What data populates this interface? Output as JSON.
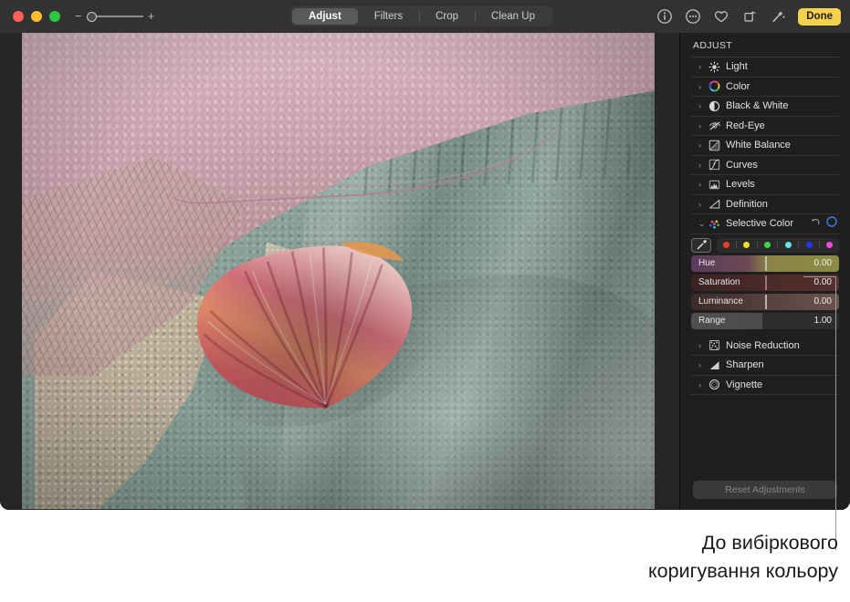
{
  "window": {
    "traffic_lights": [
      "close",
      "minimize",
      "zoom"
    ],
    "zoom_control": {
      "minus": "−",
      "plus": "+",
      "value_position_pct": 0
    }
  },
  "toolbar": {
    "tabs": [
      {
        "label": "Adjust",
        "active": true
      },
      {
        "label": "Filters",
        "active": false
      },
      {
        "label": "Crop",
        "active": false
      },
      {
        "label": "Clean Up",
        "active": false
      }
    ],
    "icons": [
      {
        "name": "info-icon"
      },
      {
        "name": "more-options-icon"
      },
      {
        "name": "favorite-heart-icon"
      },
      {
        "name": "rotate-icon"
      },
      {
        "name": "auto-enhance-wand-icon"
      }
    ],
    "done_label": "Done",
    "done_color": "#f5d24d"
  },
  "sidebar": {
    "title": "ADJUST",
    "items": [
      {
        "label": "Light",
        "icon": "light-sun-icon",
        "expanded": false
      },
      {
        "label": "Color",
        "icon": "color-wheel-icon",
        "expanded": false
      },
      {
        "label": "Black & White",
        "icon": "black-and-white-icon",
        "expanded": false
      },
      {
        "label": "Red-Eye",
        "icon": "red-eye-icon",
        "expanded": false
      },
      {
        "label": "White Balance",
        "icon": "white-balance-icon",
        "expanded": false
      },
      {
        "label": "Curves",
        "icon": "curves-icon",
        "expanded": false
      },
      {
        "label": "Levels",
        "icon": "levels-icon",
        "expanded": false
      },
      {
        "label": "Definition",
        "icon": "definition-icon",
        "expanded": false
      },
      {
        "label": "Selective Color",
        "icon": "selective-color-icon",
        "expanded": true
      },
      {
        "label": "Noise Reduction",
        "icon": "noise-reduction-icon",
        "expanded": false
      },
      {
        "label": "Sharpen",
        "icon": "sharpen-icon",
        "expanded": false
      },
      {
        "label": "Vignette",
        "icon": "vignette-icon",
        "expanded": false
      }
    ],
    "selective_color": {
      "reset_icon": "revert-arrow-icon",
      "toggle_icon": "on-off-circle-icon",
      "eyedropper_icon": "eyedropper-icon",
      "swatches": [
        {
          "name": "swatch-red",
          "color": "#f0392b"
        },
        {
          "name": "swatch-yellow",
          "color": "#f2dd2b"
        },
        {
          "name": "swatch-green",
          "color": "#3ed44a"
        },
        {
          "name": "swatch-cyan",
          "color": "#5fe8ee"
        },
        {
          "name": "swatch-blue",
          "color": "#2333ee"
        },
        {
          "name": "swatch-magenta",
          "color": "#ef48e6"
        }
      ],
      "sliders": [
        {
          "name": "Hue",
          "value": "0.00",
          "fill_from": "#5b3a5e",
          "fill_to": "#8d8a45",
          "mark_pct": 50
        },
        {
          "name": "Saturation",
          "value": "0.00",
          "fill_from": "#3a2323",
          "fill_to": "#55302e",
          "mark_pct": 50
        },
        {
          "name": "Luminance",
          "value": "0.00",
          "fill_from": "#3b2a27",
          "fill_to": "#6b5450",
          "mark_pct": 50
        },
        {
          "name": "Range",
          "value": "1.00",
          "fill_from": "#4a4a4a",
          "fill_to": "#2e2e2e",
          "mark_pct": 100
        }
      ]
    },
    "reset_button": "Reset Adjustments"
  },
  "photo": {
    "alt": "Close-up of a pink scallop shell resting on a teal towel with sand and pink sea-fan coral"
  },
  "caption": {
    "line1": "До вибіркового",
    "line2": "коригування кольору"
  }
}
